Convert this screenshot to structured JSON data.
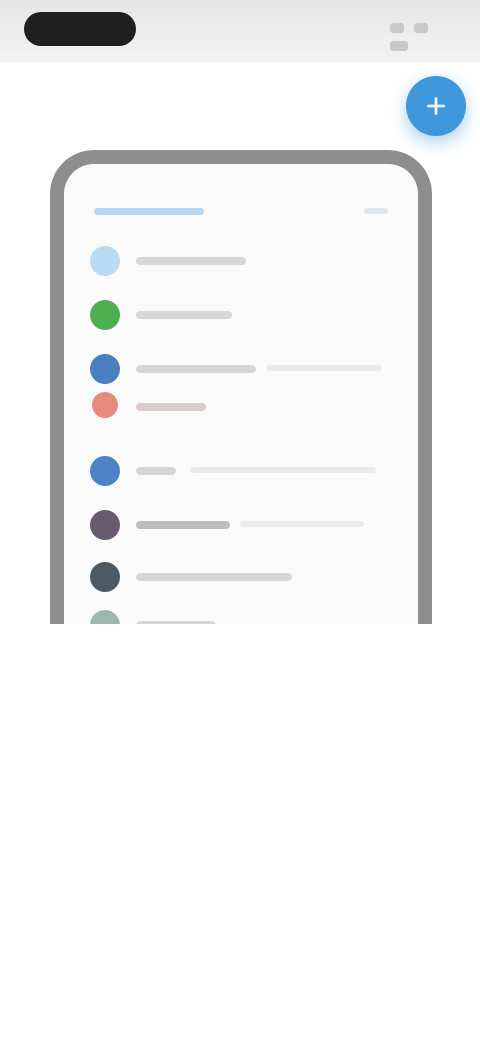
{
  "status_bar": {
    "icons": [
      "signal-icon",
      "wifi-icon",
      "battery-icon"
    ]
  },
  "header": {
    "title": "",
    "fab_icon": "plus-icon",
    "fab_color": "#3f97db"
  },
  "phone_preview": {
    "header_title": "",
    "items": [
      {
        "icon_color": "#b9dcf4",
        "label": ""
      },
      {
        "icon_color": "#4caf50",
        "label": ""
      },
      {
        "icon_color": "#4a7fc1",
        "label": ""
      },
      {
        "icon_color": "#e88a7e",
        "label": ""
      },
      {
        "icon_color": "#4e83c9",
        "label": ""
      },
      {
        "icon_color": "#6a5a6e",
        "label": ""
      },
      {
        "icon_color": "#4d5963",
        "label": ""
      },
      {
        "icon_color": "#9fb7b0",
        "label": ""
      }
    ]
  },
  "caption": {
    "line1": "",
    "line2": ""
  },
  "bottom_button": {
    "label": ""
  }
}
